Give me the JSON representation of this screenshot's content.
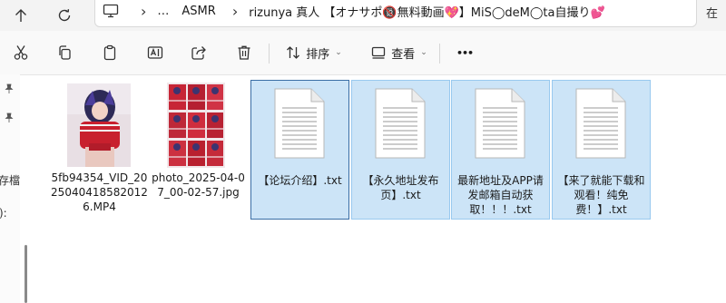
{
  "address_bar": {
    "segments": [
      "…",
      "ASMR",
      "rizunya 真人 【オナサポ🔞無料動画💖】MiS◯deM◯ta自撮り💕"
    ],
    "right_text": "在"
  },
  "toolbar": {
    "sort_label": "排序",
    "view_label": "查看",
    "more_label": "•••"
  },
  "navpane": {
    "fragments": [
      "存檔",
      "):"
    ]
  },
  "files": [
    {
      "name": "5fb94354_VID_20250404185820126.MP4",
      "type": "video"
    },
    {
      "name": "photo_2025-04-07_00-02-57.jpg",
      "type": "image"
    },
    {
      "name": "【论坛介绍】.txt",
      "type": "txt",
      "selected": true
    },
    {
      "name": "【永久地址发布页】.txt",
      "type": "txt",
      "selected": true
    },
    {
      "name": "最新地址及APP请发邮箱自动获取！！！.txt",
      "type": "txt",
      "selected": true
    },
    {
      "name": "【来了就能下载和观看！纯免费！】.txt",
      "type": "txt",
      "selected": true
    }
  ]
}
